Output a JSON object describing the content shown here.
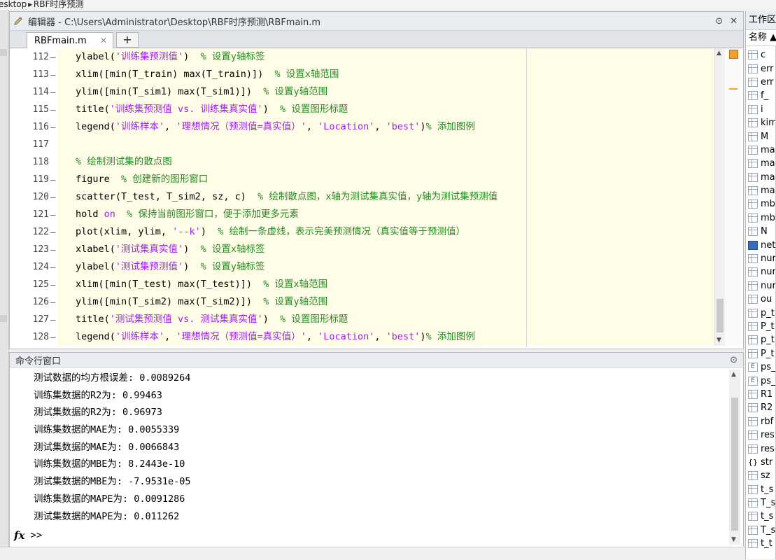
{
  "breadcrumb": [
    "esktop",
    "RBF时序预测"
  ],
  "editor": {
    "title": "编辑器 - C:\\Users\\Administrator\\Desktop\\RBF时序预测\\RBFmain.m",
    "tab_label": "RBFmain.m",
    "tab_close": "✕",
    "tab_add": "+",
    "controls": [
      "⊙",
      "✕"
    ],
    "lines": [
      {
        "num": "112",
        "mark": "—",
        "parts": [
          {
            "t": "k",
            "v": "ylabel("
          },
          {
            "t": "s",
            "v": "'训练集预测值'"
          },
          {
            "t": "k",
            "v": ")  "
          },
          {
            "t": "c",
            "v": "% 设置y轴标签"
          }
        ]
      },
      {
        "num": "113",
        "mark": "—",
        "parts": [
          {
            "t": "k",
            "v": "xlim([min(T_train) max(T_train)])  "
          },
          {
            "t": "c",
            "v": "% 设置x轴范围"
          }
        ]
      },
      {
        "num": "114",
        "mark": "—",
        "parts": [
          {
            "t": "k",
            "v": "ylim([min(T_sim1) max(T_sim1)])  "
          },
          {
            "t": "c",
            "v": "% 设置y轴范围"
          }
        ]
      },
      {
        "num": "115",
        "mark": "—",
        "parts": [
          {
            "t": "k",
            "v": "title("
          },
          {
            "t": "s",
            "v": "'训练集预测值 vs. 训练集真实值'"
          },
          {
            "t": "k",
            "v": ")  "
          },
          {
            "t": "c",
            "v": "% 设置图形标题"
          }
        ]
      },
      {
        "num": "116",
        "mark": "—",
        "parts": [
          {
            "t": "k",
            "v": "legend("
          },
          {
            "t": "s",
            "v": "'训练样本'"
          },
          {
            "t": "k",
            "v": ", "
          },
          {
            "t": "s",
            "v": "'理想情况（预测值=真实值）'"
          },
          {
            "t": "k",
            "v": ", "
          },
          {
            "t": "s",
            "v": "'Location'"
          },
          {
            "t": "k",
            "v": ", "
          },
          {
            "t": "s",
            "v": "'best'"
          },
          {
            "t": "k",
            "v": ")"
          },
          {
            "t": "c",
            "v": "% 添加图例"
          }
        ]
      },
      {
        "num": "117",
        "mark": "",
        "parts": []
      },
      {
        "num": "118",
        "mark": "",
        "parts": [
          {
            "t": "c",
            "v": "% 绘制测试集的散点图"
          }
        ]
      },
      {
        "num": "119",
        "mark": "—",
        "parts": [
          {
            "t": "k",
            "v": "figure  "
          },
          {
            "t": "c",
            "v": "% 创建新的图形窗口"
          }
        ]
      },
      {
        "num": "120",
        "mark": "—",
        "parts": [
          {
            "t": "k",
            "v": "scatter(T_test, T_sim2, sz, c)  "
          },
          {
            "t": "c",
            "v": "% 绘制散点图，x轴为测试集真实值，y轴为测试集预测值"
          }
        ]
      },
      {
        "num": "121",
        "mark": "—",
        "parts": [
          {
            "t": "k",
            "v": "hold "
          },
          {
            "t": "s",
            "v": "on"
          },
          {
            "t": "k",
            "v": "  "
          },
          {
            "t": "c",
            "v": "% 保持当前图形窗口，便于添加更多元素"
          }
        ]
      },
      {
        "num": "122",
        "mark": "—",
        "parts": [
          {
            "t": "k",
            "v": "plot(xlim, ylim, "
          },
          {
            "t": "s",
            "v": "'--k'"
          },
          {
            "t": "k",
            "v": ")  "
          },
          {
            "t": "c",
            "v": "% 绘制一条虚线，表示完美预测情况（真实值等于预测值）"
          }
        ]
      },
      {
        "num": "123",
        "mark": "—",
        "parts": [
          {
            "t": "k",
            "v": "xlabel("
          },
          {
            "t": "s",
            "v": "'测试集真实值'"
          },
          {
            "t": "k",
            "v": ")  "
          },
          {
            "t": "c",
            "v": "% 设置x轴标签"
          }
        ]
      },
      {
        "num": "124",
        "mark": "—",
        "parts": [
          {
            "t": "k",
            "v": "ylabel("
          },
          {
            "t": "s",
            "v": "'测试集预测值'"
          },
          {
            "t": "k",
            "v": ")  "
          },
          {
            "t": "c",
            "v": "% 设置y轴标签"
          }
        ]
      },
      {
        "num": "125",
        "mark": "—",
        "parts": [
          {
            "t": "k",
            "v": "xlim([min(T_test) max(T_test)])  "
          },
          {
            "t": "c",
            "v": "% 设置x轴范围"
          }
        ]
      },
      {
        "num": "126",
        "mark": "—",
        "parts": [
          {
            "t": "k",
            "v": "ylim([min(T_sim2) max(T_sim2)])  "
          },
          {
            "t": "c",
            "v": "% 设置y轴范围"
          }
        ]
      },
      {
        "num": "127",
        "mark": "—",
        "parts": [
          {
            "t": "k",
            "v": "title("
          },
          {
            "t": "s",
            "v": "'测试集预测值 vs. 测试集真实值'"
          },
          {
            "t": "k",
            "v": ")  "
          },
          {
            "t": "c",
            "v": "% 设置图形标题"
          }
        ]
      },
      {
        "num": "128",
        "mark": "—",
        "parts": [
          {
            "t": "k",
            "v": "legend("
          },
          {
            "t": "s",
            "v": "'训练样本'"
          },
          {
            "t": "k",
            "v": ", "
          },
          {
            "t": "s",
            "v": "'理想情况（预测值=真实值）'"
          },
          {
            "t": "k",
            "v": ", "
          },
          {
            "t": "s",
            "v": "'Location'"
          },
          {
            "t": "k",
            "v": ", "
          },
          {
            "t": "s",
            "v": "'best'"
          },
          {
            "t": "k",
            "v": ")"
          },
          {
            "t": "c",
            "v": "% 添加图例"
          }
        ]
      }
    ]
  },
  "command_window": {
    "title": "命令行窗口",
    "menu": "⊙",
    "lines": [
      "测试数据的均方根误差: 0.0089264",
      "训练集数据的R2为: 0.99463",
      "测试集数据的R2为: 0.96973",
      "训练集数据的MAE为: 0.0055339",
      "测试集数据的MAE为: 0.0066843",
      "训练集数据的MBE为: 8.2443e-10",
      "测试集数据的MBE为: -7.9531e-05",
      "训练集数据的MAPE为: 0.0091286",
      "测试集数据的MAPE为: 0.011262"
    ],
    "prompt_fx": "fx",
    "prompt": ">>"
  },
  "workspace": {
    "title": "工作区",
    "header": "名称 ▲",
    "vars": [
      {
        "name": "c",
        "icon": "grid"
      },
      {
        "name": "err",
        "icon": "grid"
      },
      {
        "name": "err",
        "icon": "grid"
      },
      {
        "name": "f_",
        "icon": "grid"
      },
      {
        "name": "i",
        "icon": "grid"
      },
      {
        "name": "kim",
        "icon": "grid"
      },
      {
        "name": "M",
        "icon": "grid"
      },
      {
        "name": "ma",
        "icon": "grid"
      },
      {
        "name": "ma",
        "icon": "grid"
      },
      {
        "name": "ma",
        "icon": "grid"
      },
      {
        "name": "ma",
        "icon": "grid"
      },
      {
        "name": "mb",
        "icon": "grid"
      },
      {
        "name": "mb",
        "icon": "grid"
      },
      {
        "name": "N",
        "icon": "grid"
      },
      {
        "name": "net",
        "icon": "obj"
      },
      {
        "name": "nur",
        "icon": "grid"
      },
      {
        "name": "nur",
        "icon": "grid"
      },
      {
        "name": "nur",
        "icon": "grid"
      },
      {
        "name": "ou",
        "icon": "grid"
      },
      {
        "name": "p_t",
        "icon": "grid"
      },
      {
        "name": "P_t",
        "icon": "grid"
      },
      {
        "name": "p_t",
        "icon": "grid"
      },
      {
        "name": "P_t",
        "icon": "grid"
      },
      {
        "name": "ps_",
        "icon": "char"
      },
      {
        "name": "ps_",
        "icon": "char"
      },
      {
        "name": "R1",
        "icon": "grid"
      },
      {
        "name": "R2",
        "icon": "grid"
      },
      {
        "name": "rbf",
        "icon": "grid"
      },
      {
        "name": "res",
        "icon": "grid"
      },
      {
        "name": "res",
        "icon": "grid"
      },
      {
        "name": "str",
        "icon": "struct"
      },
      {
        "name": "sz",
        "icon": "grid"
      },
      {
        "name": "t_s",
        "icon": "grid"
      },
      {
        "name": "T_s",
        "icon": "grid"
      },
      {
        "name": "t_s",
        "icon": "grid"
      },
      {
        "name": "T_s",
        "icon": "grid"
      },
      {
        "name": "t_t",
        "icon": "grid"
      }
    ]
  }
}
